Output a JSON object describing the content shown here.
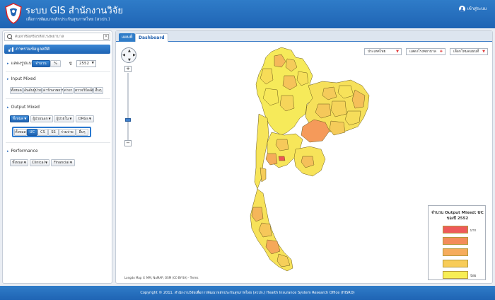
{
  "header": {
    "title": "ระบบ GIS สำนักงานวิจัย",
    "subtitle": "เพื่อการพัฒนาหลักประกันสุขภาพไทย (สวปก.)",
    "login_label": "เข้าสู่ระบบ"
  },
  "sidebar": {
    "search_placeholder": "ค้นหาชื่อหรือรหัสโรงพยาบาล",
    "panel_title": "ภาพรวมข้อมูลสถิติ",
    "display": {
      "label": "แสดงรูปแบบ",
      "options": [
        "จำนวน",
        "%"
      ],
      "selected": "จำนวน",
      "year_label": "ปี",
      "year_value": "2552"
    },
    "input_mixed": {
      "label": "Input Mixed",
      "buttons": [
        "ทั้งหมด",
        "อันดับผู้ป่วย",
        "ค่ารักษาพยาบาล",
        "ค่ายา",
        "ตรวจวินิจฉัย",
        "อื่นๆ"
      ]
    },
    "output_mixed": {
      "label": "Output Mixed",
      "dropdowns": [
        "ทั้งหมด",
        "ผู้ป่วยนอก",
        "ผู้ป่วยใน",
        "DRGs"
      ],
      "schemes": [
        "ทั้งหมด",
        "UC",
        "CS",
        "SS",
        "ร่วมจ่าย",
        "อื่นๆ"
      ],
      "selected_scheme": "UC"
    },
    "performance": {
      "label": "Performance",
      "dropdowns": [
        "ทั้งหมด",
        "Clinical",
        "Financial"
      ]
    }
  },
  "main": {
    "tabs": [
      "แผนที่",
      "Dashboard"
    ],
    "active_tab": "แผนที่",
    "map_controls": {
      "region_select": "ประเทศไทย",
      "hospital_toggle": "แสดงโรงพยาบาล",
      "layer_select": "เลือกโหมดแผนที่",
      "attribution": "Longdo Map © MM, NuMAP, OSM (CC-BY-SA) - Terms"
    },
    "legend": {
      "title": "จำนวน Output Mixed: UC ของปี 2552",
      "high_label": "มาก",
      "low_label": "น้อย",
      "colors": [
        "#ee5a5a",
        "#f38c5a",
        "#f6ac5c",
        "#f8cc58",
        "#f7ee55"
      ]
    }
  },
  "footer": {
    "copyright": "Copyright © 2011. สำนักงานวิจัยเพื่อการพัฒนาหลักประกันสุขภาพไทย (สวปก.) Health Insurance System Research Office (HISRO)"
  }
}
